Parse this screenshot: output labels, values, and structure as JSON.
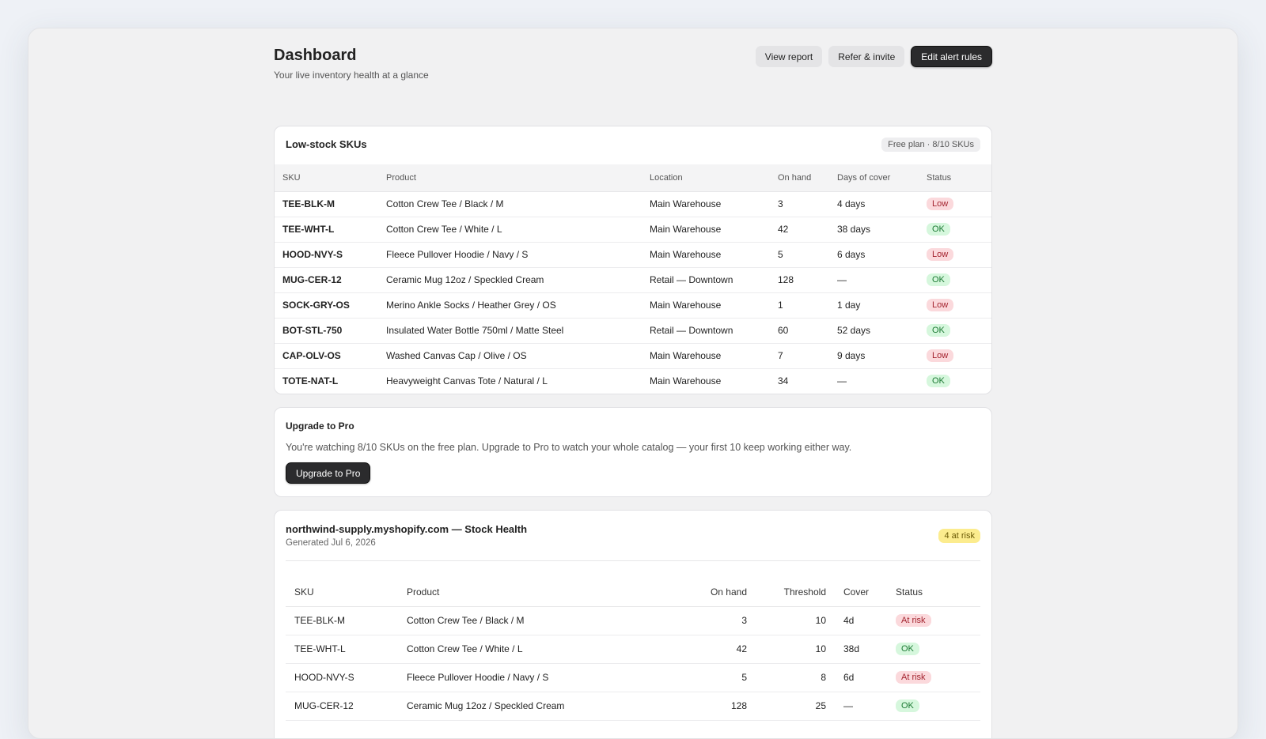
{
  "header": {
    "title": "Dashboard",
    "subtitle": "Your live inventory health at a glance",
    "actions": [
      "View report",
      "Refer & invite",
      "Edit alert rules"
    ]
  },
  "low_stock": {
    "title": "Low-stock SKUs",
    "plan_badge": "Free plan · 8/10 SKUs",
    "columns": [
      "SKU",
      "Product",
      "Location",
      "On hand",
      "Days of cover",
      "Status"
    ],
    "rows": [
      {
        "sku": "TEE-BLK-M",
        "product": "Cotton Crew Tee / Black / M",
        "location": "Main Warehouse",
        "on_hand": "3",
        "cover": "4 days",
        "status": "Low"
      },
      {
        "sku": "TEE-WHT-L",
        "product": "Cotton Crew Tee / White / L",
        "location": "Main Warehouse",
        "on_hand": "42",
        "cover": "38 days",
        "status": "OK"
      },
      {
        "sku": "HOOD-NVY-S",
        "product": "Fleece Pullover Hoodie / Navy / S",
        "location": "Main Warehouse",
        "on_hand": "5",
        "cover": "6 days",
        "status": "Low"
      },
      {
        "sku": "MUG-CER-12",
        "product": "Ceramic Mug 12oz / Speckled Cream",
        "location": "Retail — Downtown",
        "on_hand": "128",
        "cover": "—",
        "status": "OK"
      },
      {
        "sku": "SOCK-GRY-OS",
        "product": "Merino Ankle Socks / Heather Grey / OS",
        "location": "Main Warehouse",
        "on_hand": "1",
        "cover": "1 day",
        "status": "Low"
      },
      {
        "sku": "BOT-STL-750",
        "product": "Insulated Water Bottle 750ml / Matte Steel",
        "location": "Retail — Downtown",
        "on_hand": "60",
        "cover": "52 days",
        "status": "OK"
      },
      {
        "sku": "CAP-OLV-OS",
        "product": "Washed Canvas Cap / Olive / OS",
        "location": "Main Warehouse",
        "on_hand": "7",
        "cover": "9 days",
        "status": "Low"
      },
      {
        "sku": "TOTE-NAT-L",
        "product": "Heavyweight Canvas Tote / Natural / L",
        "location": "Main Warehouse",
        "on_hand": "34",
        "cover": "—",
        "status": "OK"
      }
    ]
  },
  "upgrade": {
    "title": "Upgrade to Pro",
    "text": "You're watching 8/10 SKUs on the free plan. Upgrade to Pro to watch your whole catalog — your first 10 keep working either way.",
    "button": "Upgrade to Pro"
  },
  "report": {
    "title": "northwind-supply.myshopify.com — Stock Health",
    "generated": "Generated Jul 6, 2026",
    "risk_badge": "4 at risk",
    "columns": [
      "SKU",
      "Product",
      "On hand",
      "Threshold",
      "Cover",
      "Status"
    ],
    "rows": [
      {
        "sku": "TEE-BLK-M",
        "product": "Cotton Crew Tee / Black / M",
        "on_hand": "3",
        "threshold": "10",
        "cover": "4d",
        "status": "At risk"
      },
      {
        "sku": "TEE-WHT-L",
        "product": "Cotton Crew Tee / White / L",
        "on_hand": "42",
        "threshold": "10",
        "cover": "38d",
        "status": "OK"
      },
      {
        "sku": "HOOD-NVY-S",
        "product": "Fleece Pullover Hoodie / Navy / S",
        "on_hand": "5",
        "threshold": "8",
        "cover": "6d",
        "status": "At risk"
      },
      {
        "sku": "MUG-CER-12",
        "product": "Ceramic Mug 12oz / Speckled Cream",
        "on_hand": "128",
        "threshold": "25",
        "cover": "—",
        "status": "OK"
      }
    ]
  },
  "colors": {
    "low_bg": "#fbd9dc",
    "low_fg": "#a3232e",
    "ok_bg": "#d6f7dd",
    "ok_fg": "#1c7a33",
    "risk_bg": "#fcec8e",
    "primary_button": "#2b2b2d"
  }
}
